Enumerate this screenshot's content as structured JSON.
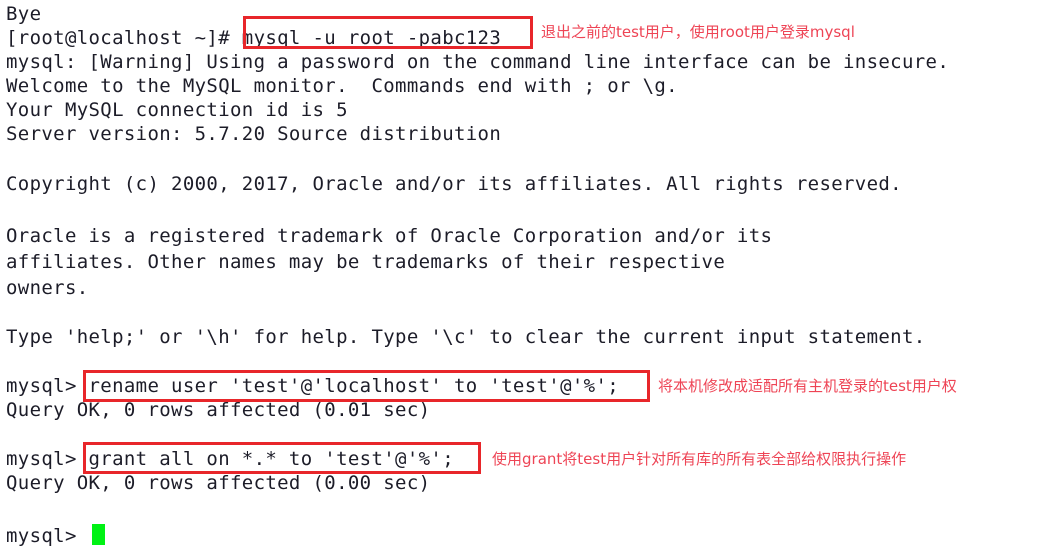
{
  "terminal": {
    "background_color": "#ffffff",
    "text_color": "#1c1c28",
    "annotation_color": "#ee4455",
    "box_color": "#e8262a",
    "cursor_color": "#00f214",
    "lines": [
      {
        "id": "l0",
        "text": "Bye"
      },
      {
        "id": "l1",
        "text": "[root@localhost ~]# mysql -u root -pabc123"
      },
      {
        "id": "l2",
        "text": "mysql: [Warning] Using a password on the command line interface can be insecure."
      },
      {
        "id": "l3",
        "text": "Welcome to the MySQL monitor.  Commands end with ; or \\g."
      },
      {
        "id": "l4",
        "text": "Your MySQL connection id is 5"
      },
      {
        "id": "l5",
        "text": "Server version: 5.7.20 Source distribution"
      },
      {
        "id": "l6",
        "text": ""
      },
      {
        "id": "l7",
        "text": "Copyright (c) 2000, 2017, Oracle and/or its affiliates. All rights reserved."
      },
      {
        "id": "l8",
        "text": ""
      },
      {
        "id": "l9",
        "text": "Oracle is a registered trademark of Oracle Corporation and/or its"
      },
      {
        "id": "l10",
        "text": "affiliates. Other names may be trademarks of their respective"
      },
      {
        "id": "l11",
        "text": "owners."
      },
      {
        "id": "l12",
        "text": ""
      },
      {
        "id": "l13",
        "text": "Type 'help;' or '\\h' for help. Type '\\c' to clear the current input statement."
      },
      {
        "id": "l14",
        "text": ""
      },
      {
        "id": "l15",
        "text": "mysql> rename user 'test'@'localhost' to 'test'@'%';"
      },
      {
        "id": "l16",
        "text": "Query OK, 0 rows affected (0.01 sec)"
      },
      {
        "id": "l17",
        "text": ""
      },
      {
        "id": "l18",
        "text": "mysql> grant all on *.* to 'test'@'%';"
      },
      {
        "id": "l19",
        "text": "Query OK, 0 rows affected (0.00 sec)"
      },
      {
        "id": "l20",
        "text": ""
      },
      {
        "id": "l21",
        "text": "mysql>"
      }
    ],
    "prompt_shell": "[root@localhost ~]#",
    "prompt_mysql": "mysql>"
  },
  "annotations": [
    {
      "id": "a1",
      "note": "退出之前的test用户，使用root用户登录mysql",
      "highlighted_command": "mysql -u root -pabc123"
    },
    {
      "id": "a2",
      "note": "将本机修改成适配所有主机登录的test用户权",
      "highlighted_command": "rename user 'test'@'localhost' to 'test'@'%';"
    },
    {
      "id": "a3",
      "note": "使用grant将test用户针对所有库的所有表全部给权限执行操作",
      "highlighted_command": "grant all on *.* to 'test'@'%';"
    }
  ]
}
